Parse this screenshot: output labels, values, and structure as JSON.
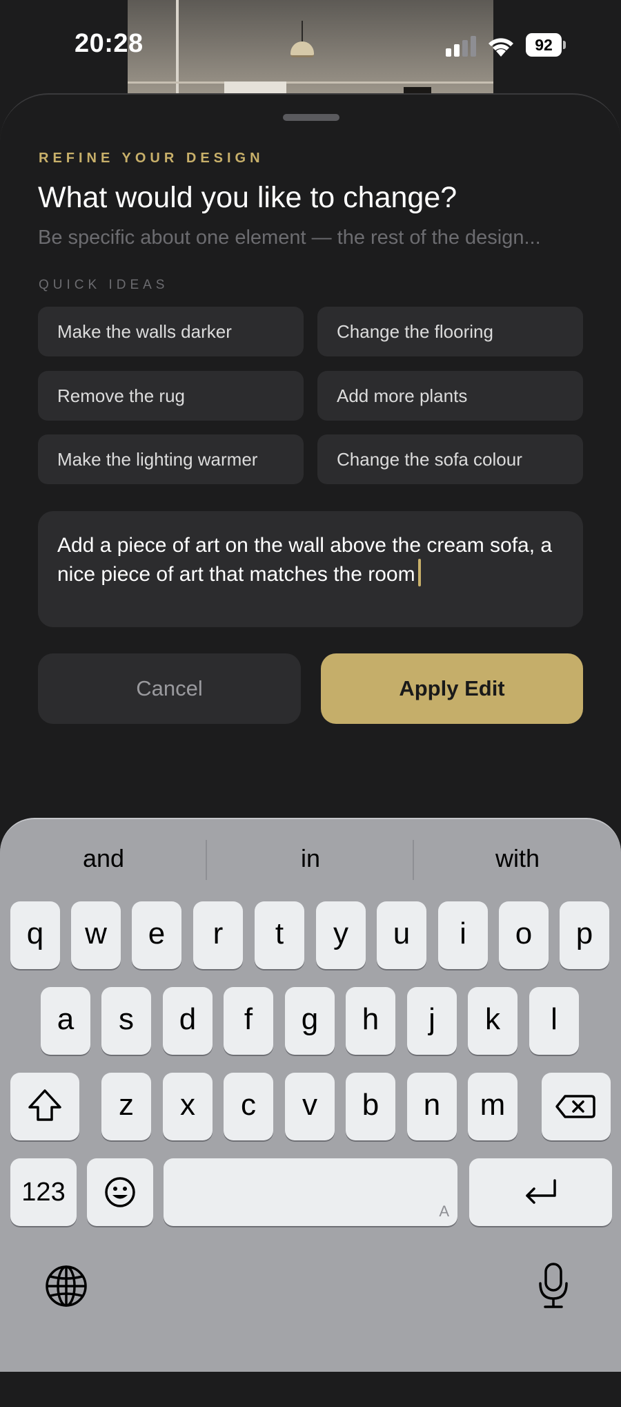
{
  "status_bar": {
    "time": "20:28",
    "battery": "92"
  },
  "sheet": {
    "eyebrow": "REFINE YOUR DESIGN",
    "title": "What would you like to change?",
    "subtitle": "Be specific about one element — the rest of the design...",
    "quick_ideas_label": "QUICK IDEAS",
    "quick_ideas": [
      "Make the walls darker",
      "Change the flooring",
      "Remove the rug",
      "Add more plants",
      "Make the lighting warmer",
      "Change the sofa colour"
    ],
    "edit_text": "Add a piece of art on the wall above the cream sofa, a nice piece of art that matches the room",
    "cancel_label": "Cancel",
    "apply_label": "Apply Edit"
  },
  "keyboard": {
    "suggestions": [
      "and",
      "in",
      "with"
    ],
    "row1": [
      "q",
      "w",
      "e",
      "r",
      "t",
      "y",
      "u",
      "i",
      "o",
      "p"
    ],
    "row2": [
      "a",
      "s",
      "d",
      "f",
      "g",
      "h",
      "j",
      "k",
      "l"
    ],
    "row3": [
      "z",
      "x",
      "c",
      "v",
      "b",
      "n",
      "m"
    ],
    "numbers_label": "123",
    "space_hint": "A"
  },
  "colors": {
    "accent": "#c5ae6a",
    "background": "#1c1c1d",
    "chip": "#2c2c2e"
  }
}
